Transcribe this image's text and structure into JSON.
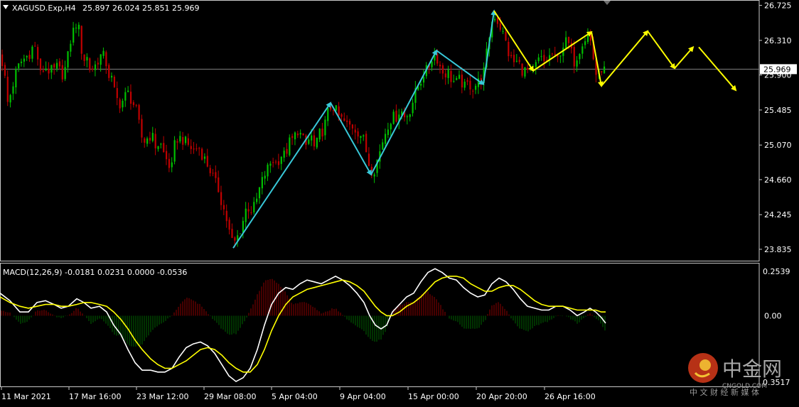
{
  "chart_data": [
    {
      "type": "candlestick",
      "symbol_label": "XAGUSD.Exp,H4",
      "ohlc_label": "25.897 26.024 25.851 25.969",
      "current_price": "25.969",
      "y_ticks": [
        "26.725",
        "26.310",
        "25.900",
        "25.485",
        "25.070",
        "24.660",
        "24.245",
        "23.835"
      ],
      "ylim": [
        23.7,
        26.78
      ],
      "x_ticks": [
        "11 Mar 2021",
        "17 Mar 16:00",
        "23 Mar 12:00",
        "29 Mar 08:00",
        "5 Apr 04:00",
        "9 Apr 04:00",
        "15 Apr 00:00",
        "20 Apr 20:00",
        "26 Apr 16:00"
      ],
      "grid": false,
      "price_path": [
        [
          0,
          26.15
        ],
        [
          6,
          25.85
        ],
        [
          10,
          25.55
        ],
        [
          16,
          25.75
        ],
        [
          22,
          25.95
        ],
        [
          28,
          26.05
        ],
        [
          34,
          26.1
        ],
        [
          40,
          26.15
        ],
        [
          46,
          26.25
        ],
        [
          50,
          26.2
        ],
        [
          56,
          25.9
        ],
        [
          62,
          26.0
        ],
        [
          68,
          25.95
        ],
        [
          74,
          25.95
        ],
        [
          80,
          26.0
        ],
        [
          86,
          25.9
        ],
        [
          92,
          26.0
        ],
        [
          98,
          26.3
        ],
        [
          103,
          26.45
        ],
        [
          108,
          26.55
        ],
        [
          112,
          26.3
        ],
        [
          116,
          26.05
        ],
        [
          120,
          26.15
        ],
        [
          126,
          25.95
        ],
        [
          132,
          26.0
        ],
        [
          138,
          26.1
        ],
        [
          143,
          26.15
        ],
        [
          148,
          26.05
        ],
        [
          152,
          25.9
        ],
        [
          156,
          25.85
        ],
        [
          160,
          25.7
        ],
        [
          166,
          25.55
        ],
        [
          172,
          25.6
        ],
        [
          178,
          25.7
        ],
        [
          184,
          25.6
        ],
        [
          190,
          25.5
        ],
        [
          196,
          25.25
        ],
        [
          200,
          25.1
        ],
        [
          206,
          25.15
        ],
        [
          212,
          25.2
        ],
        [
          218,
          25.05
        ],
        [
          224,
          25.1
        ],
        [
          230,
          24.95
        ],
        [
          236,
          24.85
        ],
        [
          240,
          24.75
        ],
        [
          244,
          25.05
        ],
        [
          248,
          25.15
        ],
        [
          254,
          25.15
        ],
        [
          260,
          25.1
        ],
        [
          266,
          25.05
        ],
        [
          272,
          25.0
        ],
        [
          278,
          25.05
        ],
        [
          284,
          24.95
        ],
        [
          290,
          24.85
        ],
        [
          296,
          24.75
        ],
        [
          300,
          24.65
        ],
        [
          306,
          24.55
        ],
        [
          312,
          24.35
        ],
        [
          316,
          24.25
        ],
        [
          320,
          24.1
        ],
        [
          324,
          23.95
        ],
        [
          328,
          23.9
        ],
        [
          334,
          24.0
        ],
        [
          340,
          24.15
        ],
        [
          346,
          24.35
        ],
        [
          352,
          24.3
        ],
        [
          358,
          24.35
        ],
        [
          364,
          24.55
        ],
        [
          370,
          24.7
        ],
        [
          376,
          24.8
        ],
        [
          382,
          24.9
        ],
        [
          388,
          24.85
        ],
        [
          394,
          24.95
        ],
        [
          400,
          24.95
        ],
        [
          406,
          25.1
        ],
        [
          412,
          25.15
        ],
        [
          418,
          25.25
        ],
        [
          424,
          25.15
        ],
        [
          430,
          25.05
        ],
        [
          436,
          25.2
        ],
        [
          442,
          25.0
        ],
        [
          448,
          25.2
        ],
        [
          454,
          25.25
        ],
        [
          460,
          25.45
        ],
        [
          466,
          25.55
        ],
        [
          470,
          25.5
        ],
        [
          476,
          25.4
        ],
        [
          482,
          25.35
        ],
        [
          488,
          25.3
        ],
        [
          494,
          25.3
        ],
        [
          500,
          25.25
        ],
        [
          506,
          25.2
        ],
        [
          512,
          25.1
        ],
        [
          516,
          24.9
        ],
        [
          520,
          24.8
        ],
        [
          524,
          24.75
        ],
        [
          528,
          24.85
        ],
        [
          532,
          24.95
        ],
        [
          538,
          25.15
        ],
        [
          544,
          25.3
        ],
        [
          550,
          25.4
        ],
        [
          556,
          25.4
        ],
        [
          562,
          25.5
        ],
        [
          568,
          25.4
        ],
        [
          574,
          25.45
        ],
        [
          580,
          25.6
        ],
        [
          586,
          25.75
        ],
        [
          592,
          25.85
        ],
        [
          596,
          25.95
        ],
        [
          600,
          25.95
        ],
        [
          606,
          26.1
        ],
        [
          612,
          26.15
        ],
        [
          618,
          26.0
        ],
        [
          624,
          25.9
        ],
        [
          628,
          25.95
        ],
        [
          634,
          25.85
        ],
        [
          640,
          25.8
        ],
        [
          646,
          25.85
        ],
        [
          652,
          25.75
        ],
        [
          658,
          25.8
        ],
        [
          664,
          25.75
        ],
        [
          670,
          25.8
        ],
        [
          676,
          25.85
        ],
        [
          680,
          25.95
        ],
        [
          686,
          26.3
        ],
        [
          690,
          26.5
        ],
        [
          694,
          26.62
        ],
        [
          698,
          26.55
        ],
        [
          704,
          26.45
        ],
        [
          710,
          26.3
        ],
        [
          716,
          26.1
        ],
        [
          722,
          26.05
        ],
        [
          728,
          26.05
        ],
        [
          734,
          25.95
        ],
        [
          740,
          25.95
        ],
        [
          746,
          25.92
        ],
        [
          752,
          26.0
        ],
        [
          758,
          26.1
        ],
        [
          764,
          26.05
        ],
        [
          770,
          26.1
        ],
        [
          776,
          26.15
        ],
        [
          782,
          26.05
        ],
        [
          788,
          26.2
        ],
        [
          794,
          26.3
        ],
        [
          800,
          26.25
        ],
        [
          806,
          26.05
        ],
        [
          812,
          26.15
        ],
        [
          818,
          26.3
        ],
        [
          824,
          26.35
        ],
        [
          828,
          26.38
        ],
        [
          832,
          26.2
        ],
        [
          836,
          25.95
        ],
        [
          840,
          25.85
        ],
        [
          844,
          26.0
        ],
        [
          848,
          25.95
        ],
        [
          852,
          25.97
        ]
      ],
      "wave_cyan": [
        [
          328,
          23.85
        ],
        [
          465,
          25.57
        ],
        [
          522,
          24.72
        ],
        [
          614,
          26.19
        ],
        [
          680,
          25.79
        ],
        [
          695,
          26.66
        ]
      ],
      "wave_yellow_solid": [
        [
          695,
          26.66
        ],
        [
          750,
          25.95
        ],
        [
          832,
          26.41
        ],
        [
          846,
          25.77
        ]
      ],
      "wave_yellow_forecast": [
        [
          846,
          25.77
        ],
        [
          911,
          26.42
        ],
        [
          949,
          25.98
        ],
        [
          975,
          26.23
        ]
      ],
      "wave_yellow_final": [
        [
          983,
          26.23
        ],
        [
          1035,
          25.72
        ]
      ]
    },
    {
      "type": "histogram+line",
      "label": "MACD(12,26,9) -0.0181 0.0231 0.0000 -0.0536",
      "y_ticks": [
        "0.2539",
        "0.00",
        "0.3517"
      ],
      "ylim": [
        -0.38,
        0.27
      ],
      "macd_path": [
        [
          0,
          0.12
        ],
        [
          14,
          0.08
        ],
        [
          28,
          0.02
        ],
        [
          40,
          0.02
        ],
        [
          52,
          0.07
        ],
        [
          64,
          0.08
        ],
        [
          76,
          0.06
        ],
        [
          86,
          0.04
        ],
        [
          96,
          0.05
        ],
        [
          108,
          0.09
        ],
        [
          118,
          0.07
        ],
        [
          128,
          0.04
        ],
        [
          140,
          0.05
        ],
        [
          150,
          0.02
        ],
        [
          160,
          -0.05
        ],
        [
          170,
          -0.1
        ],
        [
          180,
          -0.18
        ],
        [
          190,
          -0.25
        ],
        [
          200,
          -0.29
        ],
        [
          212,
          -0.29
        ],
        [
          222,
          -0.3
        ],
        [
          232,
          -0.3
        ],
        [
          242,
          -0.28
        ],
        [
          252,
          -0.22
        ],
        [
          262,
          -0.17
        ],
        [
          272,
          -0.15
        ],
        [
          282,
          -0.14
        ],
        [
          292,
          -0.16
        ],
        [
          302,
          -0.2
        ],
        [
          312,
          -0.26
        ],
        [
          322,
          -0.32
        ],
        [
          332,
          -0.35
        ],
        [
          342,
          -0.33
        ],
        [
          352,
          -0.28
        ],
        [
          362,
          -0.18
        ],
        [
          372,
          -0.05
        ],
        [
          382,
          0.06
        ],
        [
          392,
          0.12
        ],
        [
          402,
          0.15
        ],
        [
          412,
          0.14
        ],
        [
          422,
          0.17
        ],
        [
          432,
          0.19
        ],
        [
          442,
          0.18
        ],
        [
          452,
          0.17
        ],
        [
          462,
          0.19
        ],
        [
          472,
          0.21
        ],
        [
          482,
          0.19
        ],
        [
          492,
          0.16
        ],
        [
          502,
          0.12
        ],
        [
          512,
          0.07
        ],
        [
          520,
          0.0
        ],
        [
          528,
          -0.05
        ],
        [
          536,
          -0.07
        ],
        [
          544,
          -0.05
        ],
        [
          552,
          0.02
        ],
        [
          562,
          0.06
        ],
        [
          572,
          0.1
        ],
        [
          582,
          0.12
        ],
        [
          592,
          0.18
        ],
        [
          602,
          0.23
        ],
        [
          612,
          0.25
        ],
        [
          622,
          0.23
        ],
        [
          632,
          0.2
        ],
        [
          642,
          0.19
        ],
        [
          652,
          0.15
        ],
        [
          662,
          0.12
        ],
        [
          672,
          0.1
        ],
        [
          682,
          0.11
        ],
        [
          692,
          0.17
        ],
        [
          702,
          0.2
        ],
        [
          712,
          0.18
        ],
        [
          722,
          0.14
        ],
        [
          732,
          0.09
        ],
        [
          742,
          0.05
        ],
        [
          752,
          0.04
        ],
        [
          762,
          0.03
        ],
        [
          772,
          0.03
        ],
        [
          782,
          0.05
        ],
        [
          792,
          0.05
        ],
        [
          802,
          0.03
        ],
        [
          812,
          0.0
        ],
        [
          822,
          0.02
        ],
        [
          830,
          0.04
        ],
        [
          838,
          0.02
        ],
        [
          846,
          -0.01
        ],
        [
          852,
          -0.04
        ]
      ],
      "signal_path": [
        [
          0,
          0.1
        ],
        [
          14,
          0.07
        ],
        [
          28,
          0.05
        ],
        [
          40,
          0.04
        ],
        [
          52,
          0.05
        ],
        [
          64,
          0.06
        ],
        [
          76,
          0.06
        ],
        [
          86,
          0.05
        ],
        [
          96,
          0.05
        ],
        [
          108,
          0.06
        ],
        [
          118,
          0.07
        ],
        [
          128,
          0.07
        ],
        [
          140,
          0.06
        ],
        [
          150,
          0.05
        ],
        [
          160,
          0.02
        ],
        [
          170,
          -0.02
        ],
        [
          180,
          -0.07
        ],
        [
          190,
          -0.13
        ],
        [
          200,
          -0.18
        ],
        [
          212,
          -0.23
        ],
        [
          222,
          -0.26
        ],
        [
          232,
          -0.28
        ],
        [
          242,
          -0.28
        ],
        [
          252,
          -0.26
        ],
        [
          262,
          -0.24
        ],
        [
          272,
          -0.21
        ],
        [
          282,
          -0.18
        ],
        [
          292,
          -0.17
        ],
        [
          302,
          -0.18
        ],
        [
          312,
          -0.21
        ],
        [
          322,
          -0.25
        ],
        [
          332,
          -0.28
        ],
        [
          342,
          -0.3
        ],
        [
          352,
          -0.3
        ],
        [
          362,
          -0.26
        ],
        [
          372,
          -0.18
        ],
        [
          382,
          -0.08
        ],
        [
          392,
          0.0
        ],
        [
          402,
          0.06
        ],
        [
          412,
          0.1
        ],
        [
          422,
          0.12
        ],
        [
          432,
          0.14
        ],
        [
          442,
          0.15
        ],
        [
          452,
          0.16
        ],
        [
          462,
          0.17
        ],
        [
          472,
          0.18
        ],
        [
          482,
          0.19
        ],
        [
          492,
          0.18
        ],
        [
          502,
          0.16
        ],
        [
          512,
          0.13
        ],
        [
          520,
          0.09
        ],
        [
          528,
          0.05
        ],
        [
          536,
          0.02
        ],
        [
          544,
          0.0
        ],
        [
          552,
          0.0
        ],
        [
          562,
          0.02
        ],
        [
          572,
          0.05
        ],
        [
          582,
          0.07
        ],
        [
          592,
          0.1
        ],
        [
          602,
          0.14
        ],
        [
          612,
          0.18
        ],
        [
          622,
          0.2
        ],
        [
          632,
          0.21
        ],
        [
          642,
          0.21
        ],
        [
          652,
          0.2
        ],
        [
          662,
          0.17
        ],
        [
          672,
          0.15
        ],
        [
          682,
          0.13
        ],
        [
          692,
          0.13
        ],
        [
          702,
          0.15
        ],
        [
          712,
          0.16
        ],
        [
          722,
          0.16
        ],
        [
          732,
          0.14
        ],
        [
          742,
          0.11
        ],
        [
          752,
          0.08
        ],
        [
          762,
          0.06
        ],
        [
          772,
          0.05
        ],
        [
          782,
          0.05
        ],
        [
          792,
          0.05
        ],
        [
          802,
          0.04
        ],
        [
          812,
          0.03
        ],
        [
          822,
          0.03
        ],
        [
          830,
          0.03
        ],
        [
          838,
          0.03
        ],
        [
          846,
          0.02
        ],
        [
          852,
          0.02
        ]
      ]
    }
  ],
  "watermark": {
    "brand": "中金网",
    "domain": "CNGOLD.COM",
    "tagline": "中 文 财 经 新 媒 体"
  },
  "colors": {
    "background": "#000000",
    "axis": "#c8c8c8",
    "text": "#ffffff",
    "bull": "#00c000",
    "bear": "#c00000",
    "hist_pos": "#8b0000",
    "hist_neg": "#006400",
    "cyan_wave": "#38c8d8",
    "yellow_wave": "#ffff00",
    "macd_line": "#ffffff",
    "signal_line": "#ffff00",
    "price_box_bg": "#ffffff",
    "price_box_text": "#000000"
  }
}
